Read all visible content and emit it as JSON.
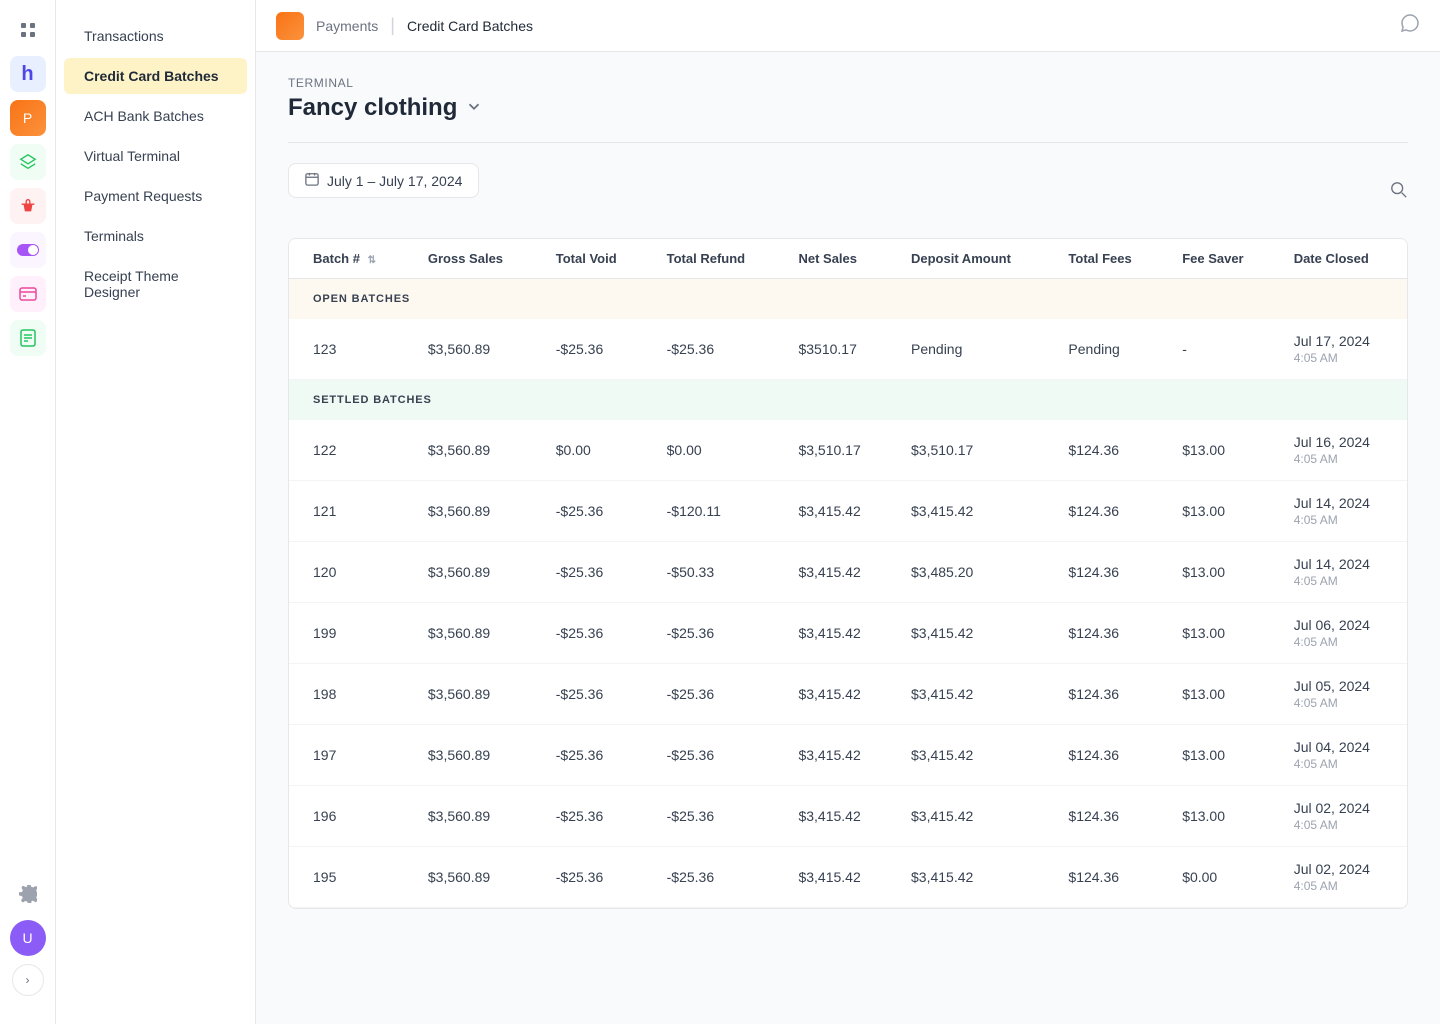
{
  "app": {
    "grid_label": "⋮⋮⋮",
    "logo_text": "P"
  },
  "topbar": {
    "app_name": "Payments",
    "separator": "|",
    "page_title": "Credit Card Batches",
    "chat_icon": "💬"
  },
  "sidebar": {
    "nav_items": [
      {
        "id": "transactions",
        "label": "Transactions",
        "active": false
      },
      {
        "id": "credit-card-batches",
        "label": "Credit Card Batches",
        "active": true
      },
      {
        "id": "ach-bank-batches",
        "label": "ACH Bank Batches",
        "active": false
      },
      {
        "id": "virtual-terminal",
        "label": "Virtual Terminal",
        "active": false
      },
      {
        "id": "payment-requests",
        "label": "Payment Requests",
        "active": false
      },
      {
        "id": "terminals",
        "label": "Terminals",
        "active": false
      },
      {
        "id": "receipt-theme-designer",
        "label": "Receipt Theme Designer",
        "active": false
      }
    ]
  },
  "terminal": {
    "label": "Terminal",
    "name": "Fancy clothing"
  },
  "date_filter": {
    "text": "July 1 – July 17, 2024"
  },
  "table": {
    "columns": [
      "Batch #",
      "Gross Sales",
      "Total Void",
      "Total Refund",
      "Net Sales",
      "Deposit Amount",
      "Total Fees",
      "Fee Saver",
      "Date Closed"
    ],
    "open_section_label": "OPEN BATCHES",
    "settled_section_label": "SETTLED BATCHES",
    "open_rows": [
      {
        "batch": "123",
        "gross_sales": "$3,560.89",
        "total_void": "-$25.36",
        "total_refund": "-$25.36",
        "net_sales": "$3510.17",
        "deposit_amount": "Pending",
        "total_fees": "Pending",
        "fee_saver": "-",
        "date_closed": "Jul 17, 2024 4:05 AM"
      }
    ],
    "settled_rows": [
      {
        "batch": "122",
        "gross_sales": "$3,560.89",
        "total_void": "$0.00",
        "total_refund": "$0.00",
        "net_sales": "$3,510.17",
        "deposit_amount": "$3,510.17",
        "total_fees": "$124.36",
        "fee_saver": "$13.00",
        "date_closed": "Jul 16, 2024 4:05 AM"
      },
      {
        "batch": "121",
        "gross_sales": "$3,560.89",
        "total_void": "-$25.36",
        "total_refund": "-$120.11",
        "net_sales": "$3,415.42",
        "deposit_amount": "$3,415.42",
        "total_fees": "$124.36",
        "fee_saver": "$13.00",
        "date_closed": "Jul 14, 2024 4:05 AM"
      },
      {
        "batch": "120",
        "gross_sales": "$3,560.89",
        "total_void": "-$25.36",
        "total_refund": "-$50.33",
        "net_sales": "$3,415.42",
        "deposit_amount": "$3,485.20",
        "total_fees": "$124.36",
        "fee_saver": "$13.00",
        "date_closed": "Jul 14, 2024 4:05 AM"
      },
      {
        "batch": "199",
        "gross_sales": "$3,560.89",
        "total_void": "-$25.36",
        "total_refund": "-$25.36",
        "net_sales": "$3,415.42",
        "deposit_amount": "$3,415.42",
        "total_fees": "$124.36",
        "fee_saver": "$13.00",
        "date_closed": "Jul 06, 2024 4:05 AM"
      },
      {
        "batch": "198",
        "gross_sales": "$3,560.89",
        "total_void": "-$25.36",
        "total_refund": "-$25.36",
        "net_sales": "$3,415.42",
        "deposit_amount": "$3,415.42",
        "total_fees": "$124.36",
        "fee_saver": "$13.00",
        "date_closed": "Jul 05, 2024 4:05 AM"
      },
      {
        "batch": "197",
        "gross_sales": "$3,560.89",
        "total_void": "-$25.36",
        "total_refund": "-$25.36",
        "net_sales": "$3,415.42",
        "deposit_amount": "$3,415.42",
        "total_fees": "$124.36",
        "fee_saver": "$13.00",
        "date_closed": "Jul 04, 2024 4:05 AM"
      },
      {
        "batch": "196",
        "gross_sales": "$3,560.89",
        "total_void": "-$25.36",
        "total_refund": "-$25.36",
        "net_sales": "$3,415.42",
        "deposit_amount": "$3,415.42",
        "total_fees": "$124.36",
        "fee_saver": "$13.00",
        "date_closed": "Jul 02, 2024 4:05 AM"
      },
      {
        "batch": "195",
        "gross_sales": "$3,560.89",
        "total_void": "-$25.36",
        "total_refund": "-$25.36",
        "net_sales": "$3,415.42",
        "deposit_amount": "$3,415.42",
        "total_fees": "$124.36",
        "fee_saver": "$0.00",
        "date_closed": "Jul 02, 2024 4:05 AM"
      }
    ]
  },
  "icons": {
    "grid": "⋮⋮⋮",
    "h_logo": "h",
    "payments": "🟧",
    "layers": "◧",
    "bucket": "🪣",
    "toggle": "⬤",
    "card": "▨",
    "document": "📄",
    "gear": "⚙",
    "avatar_initial": "U",
    "chevron_right": "›",
    "chevron_down": "⌄",
    "calendar": "📅",
    "search": "🔍"
  }
}
